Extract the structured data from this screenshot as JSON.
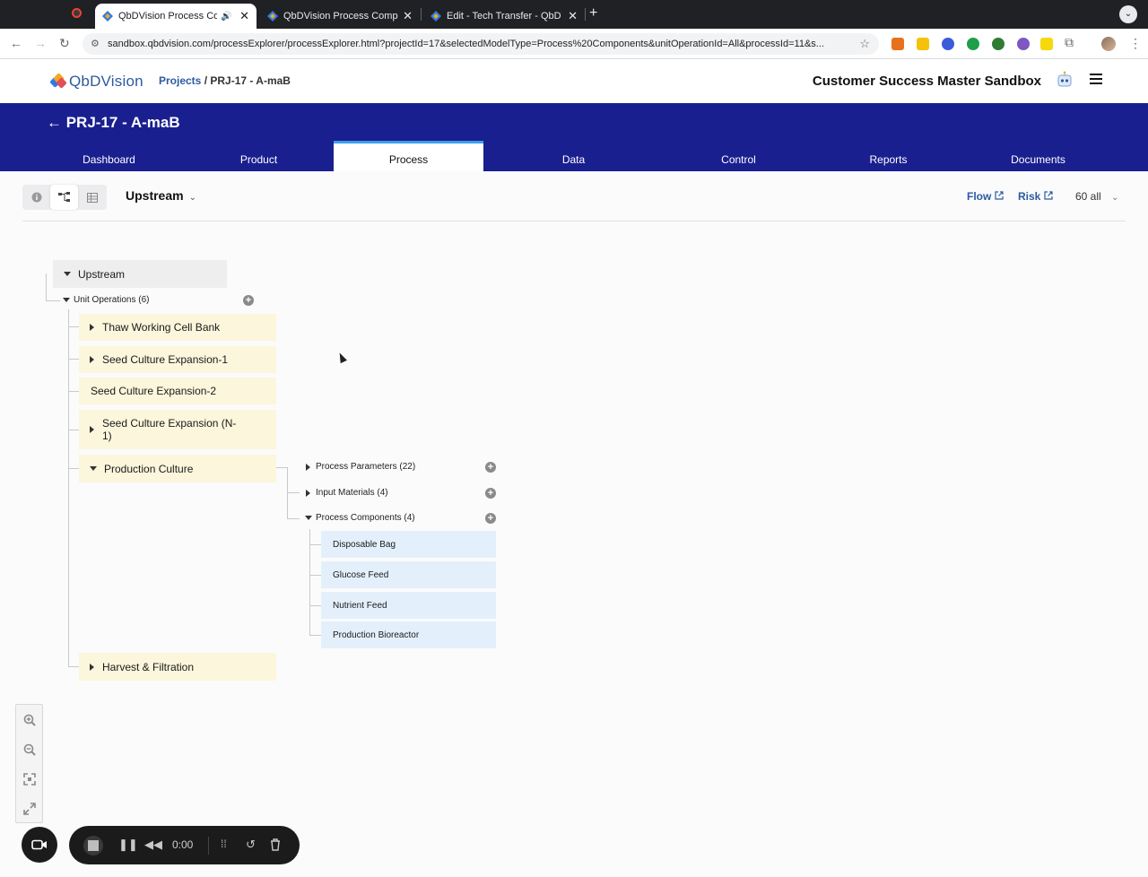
{
  "browser": {
    "tabs": [
      {
        "title": "QbDVision Process Comp",
        "active": true
      },
      {
        "title": "QbDVision Process Compone",
        "active": false
      },
      {
        "title": "Edit - Tech Transfer - QbDVis",
        "active": false
      }
    ],
    "new_tab": "+",
    "url": "sandbox.qbdvision.com/processExplorer/processExplorer.html?projectId=17&selectedModelType=Process%20Components&unitOperationId=All&processId=11&s..."
  },
  "header": {
    "logo_text": "QbDVision",
    "breadcrumb_projects": "Projects",
    "breadcrumb_sep": " / ",
    "breadcrumb_current": "PRJ-17 - A-maB",
    "workspace": "Customer Success Master Sandbox"
  },
  "band": {
    "back_title": "← PRJ-17 - A-maB",
    "tabs": [
      "Dashboard",
      "Product",
      "Process",
      "Data",
      "Control",
      "Reports",
      "Documents"
    ],
    "active_tab": "Process"
  },
  "subbar": {
    "scope": "Upstream",
    "flow": "Flow",
    "risk": "Risk",
    "count": "60 all"
  },
  "tree": {
    "root": "Upstream",
    "unit_ops_group": "Unit Operations (6)",
    "unit_operations": [
      {
        "label": "Thaw Working Cell Bank",
        "caret": "right"
      },
      {
        "label": "Seed Culture Expansion-1",
        "caret": "right"
      },
      {
        "label": "Seed Culture Expansion-2",
        "caret": "none"
      },
      {
        "label": "Seed Culture Expansion (N-1)",
        "caret": "right"
      },
      {
        "label": "Production Culture",
        "caret": "down"
      },
      {
        "label": "Harvest & Filtration",
        "caret": "right"
      }
    ],
    "groups": [
      {
        "label": "Process Parameters (22)",
        "caret": "right"
      },
      {
        "label": "Input Materials (4)",
        "caret": "right"
      },
      {
        "label": "Process Components (4)",
        "caret": "down"
      }
    ],
    "process_components": [
      "Disposable Bag",
      "Glucose Feed",
      "Nutrient Feed",
      "Production Bioreactor"
    ]
  },
  "recorder": {
    "time": "0:00"
  },
  "colors": {
    "band": "#1a1f8f",
    "accent": "#2c5aa0",
    "unit_op_bg": "#fbf6dc",
    "component_bg": "#e3f0fb"
  }
}
